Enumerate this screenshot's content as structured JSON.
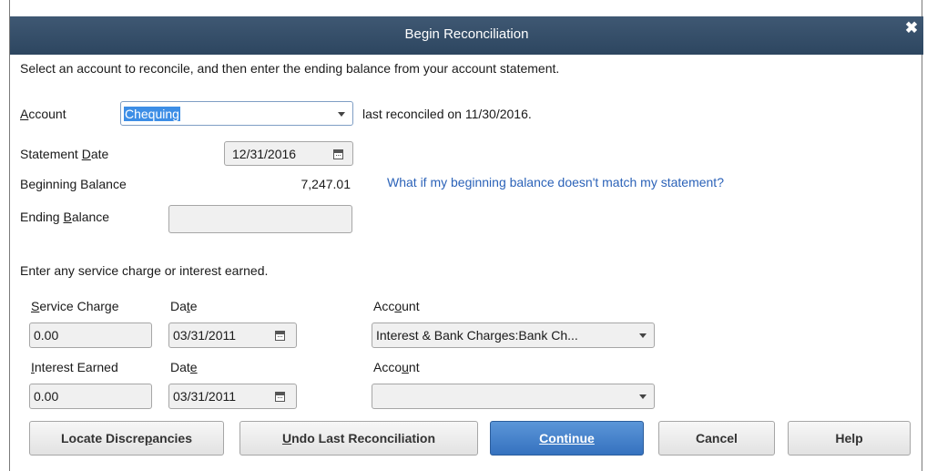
{
  "dialog": {
    "title": "Begin Reconciliation",
    "close_glyph": "✖",
    "intro": "Select an account to reconcile, and then enter the ending balance from your account statement."
  },
  "account": {
    "label_first": "A",
    "label_rest": "ccount",
    "value": "Chequing",
    "last_reconciled": "last reconciled on 11/30/2016."
  },
  "statement_date": {
    "label_pre": "Statement ",
    "label_ul": "D",
    "label_post": "ate",
    "value": "12/31/2016"
  },
  "beginning_balance": {
    "label": "Beginning Balance",
    "value": "7,247.01",
    "help_link": "What if my beginning balance doesn't match my statement?"
  },
  "ending_balance": {
    "label_pre": "Ending ",
    "label_ul": "B",
    "label_post": "alance",
    "value": ""
  },
  "charges_intro": "Enter any service charge or interest earned.",
  "service_charge": {
    "label_ul": "S",
    "label_rest": "ervice Charge",
    "value": "0.00",
    "date_label_pre": "Da",
    "date_label_ul": "t",
    "date_label_post": "e",
    "date_value": "03/31/2011",
    "account_label_pre": "Acc",
    "account_label_ul": "o",
    "account_label_post": "unt",
    "account_value": "Interest & Bank Charges:Bank Ch..."
  },
  "interest_earned": {
    "label_ul": "I",
    "label_rest": "nterest Earned",
    "value": "0.00",
    "date_label_pre": "Dat",
    "date_label_ul": "e",
    "date_label_post": "",
    "date_value": "03/31/2011",
    "account_label_pre": "Acco",
    "account_label_ul": "u",
    "account_label_post": "nt",
    "account_value": ""
  },
  "buttons": {
    "locate_pre": "Locate Discre",
    "locate_ul": "p",
    "locate_post": "ancies",
    "undo_ul": "U",
    "undo_rest": "ndo Last Reconciliation",
    "continue_ul": "C",
    "continue_rest": "ontinue",
    "cancel": "Cancel",
    "help": "Help"
  },
  "colors": {
    "titlebar": "#3f5873",
    "link": "#2b62b8",
    "primary_button": "#3a77c4",
    "selection": "#3d8ee6"
  }
}
